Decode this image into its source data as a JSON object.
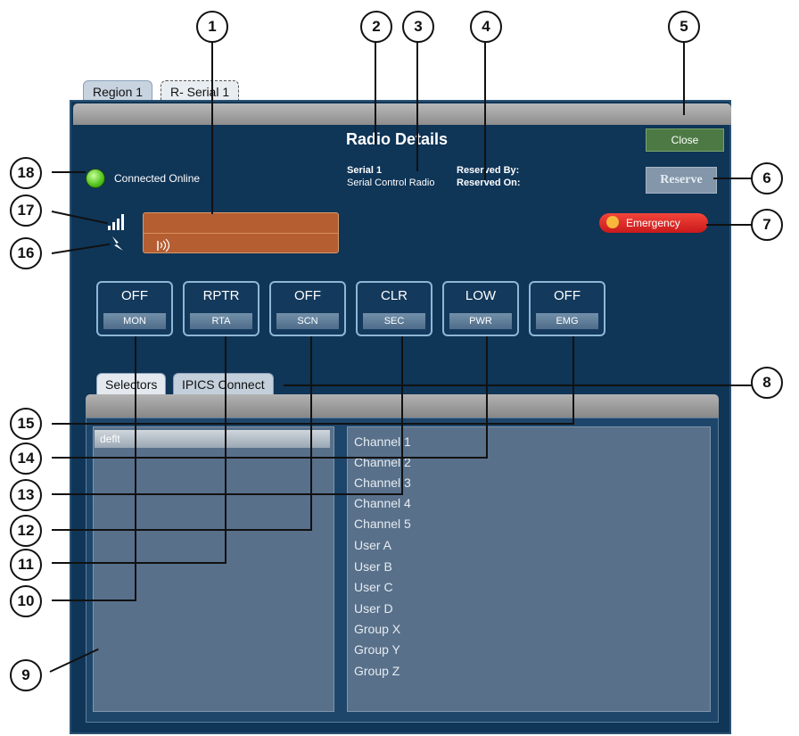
{
  "tabs": [
    "Region 1",
    "R- Serial 1"
  ],
  "header": {
    "title": "Radio Details",
    "close_label": "Close",
    "reserve_label": "Reserve",
    "emergency_label": "Emergency"
  },
  "radio": {
    "name": "Serial 1",
    "type": "Serial Control Radio",
    "reserved_by_label": "Reserved By:",
    "reserved_on_label": "Reserved On:"
  },
  "status": {
    "text": "Connected Online"
  },
  "controls": [
    {
      "value": "OFF",
      "label": "MON"
    },
    {
      "value": "RPTR",
      "label": "RTA"
    },
    {
      "value": "OFF",
      "label": "SCN"
    },
    {
      "value": "CLR",
      "label": "SEC"
    },
    {
      "value": "LOW",
      "label": "PWR"
    },
    {
      "value": "OFF",
      "label": "EMG"
    }
  ],
  "lower_tabs": [
    "Selectors",
    "IPICS Connect"
  ],
  "selectors": [
    "deflt"
  ],
  "channels": [
    "Channel 1",
    "Channel 2",
    "Channel 3",
    "Channel 4",
    "Channel 5",
    "User A",
    "User B",
    "User C",
    "User D",
    "Group X",
    "Group Y",
    "Group Z"
  ],
  "callouts": [
    "1",
    "2",
    "3",
    "4",
    "5",
    "6",
    "7",
    "8",
    "9",
    "10",
    "11",
    "12",
    "13",
    "14",
    "15",
    "16",
    "17",
    "18"
  ],
  "icons": {
    "signal": "signal-bars-icon",
    "lightning": "lightning-icon",
    "antenna": "antenna-icon",
    "emergency": "emergency-icon"
  }
}
